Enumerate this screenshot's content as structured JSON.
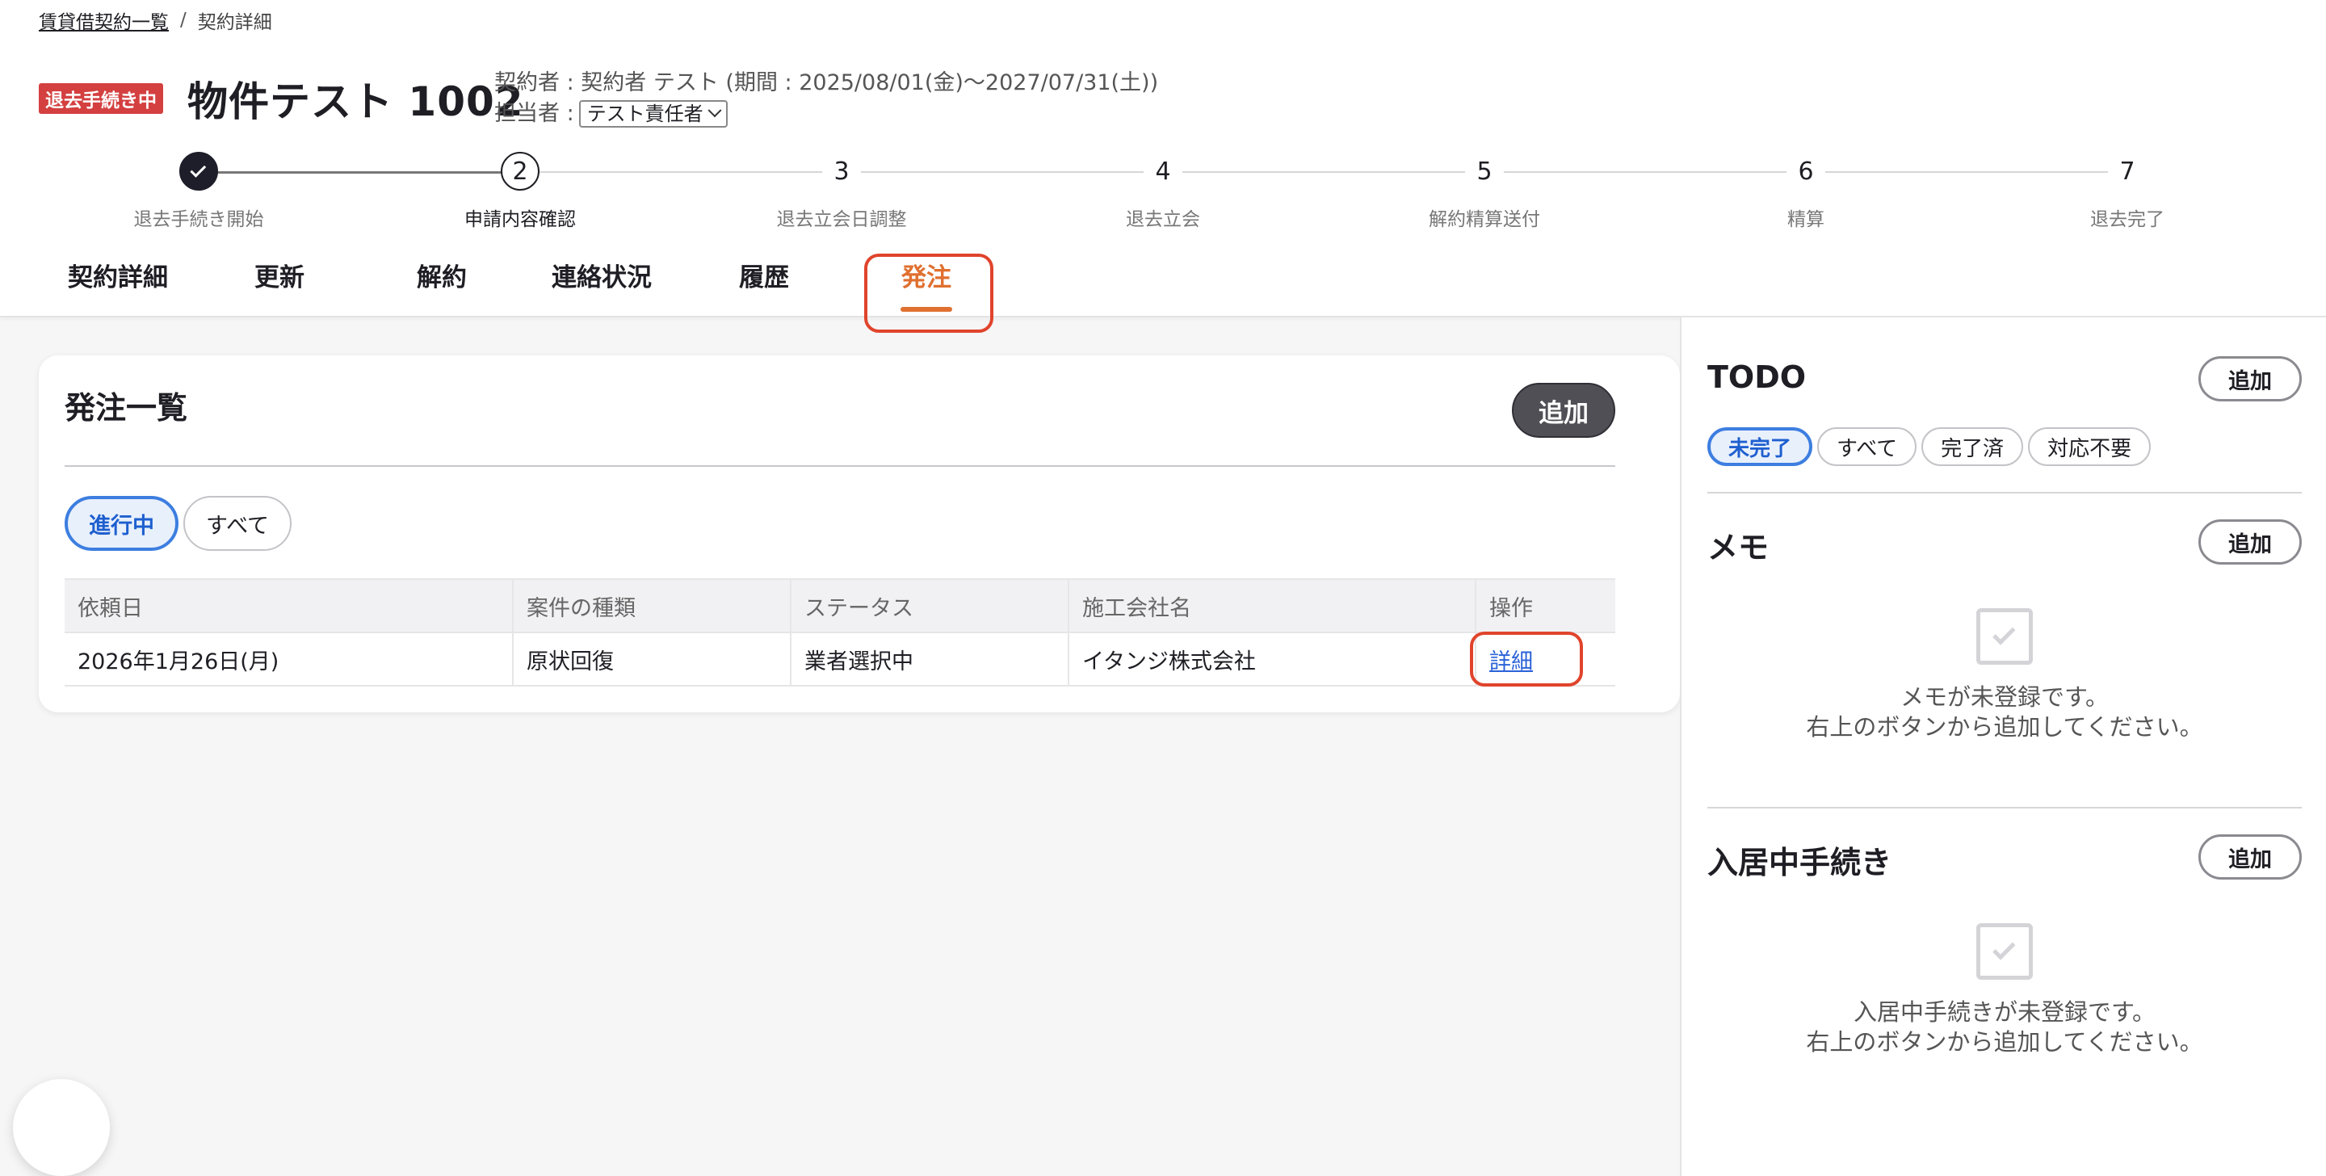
{
  "breadcrumb": {
    "parent": "賃貸借契約一覧",
    "separator": "/",
    "current": "契約詳細"
  },
  "header": {
    "status_badge": "退去手続き中",
    "property_title": "物件テスト 1002",
    "contract_info": "契約者 : 契約者 テスト (期間 : 2025/08/01(金)〜2027/07/31(土))",
    "assignee_label": "担当者 :",
    "assignee_value": "テスト責任者"
  },
  "stepper": {
    "steps": [
      {
        "number": "1",
        "label": "退去手続き開始",
        "state": "done"
      },
      {
        "number": "2",
        "label": "申請内容確認",
        "state": "current"
      },
      {
        "number": "3",
        "label": "退去立会日調整",
        "state": "pending"
      },
      {
        "number": "4",
        "label": "退去立会",
        "state": "pending"
      },
      {
        "number": "5",
        "label": "解約精算送付",
        "state": "pending"
      },
      {
        "number": "6",
        "label": "精算",
        "state": "pending"
      },
      {
        "number": "7",
        "label": "退去完了",
        "state": "pending"
      }
    ]
  },
  "tabs": [
    {
      "label": "契約詳細"
    },
    {
      "label": "更新"
    },
    {
      "label": "解約"
    },
    {
      "label": "連絡状況"
    },
    {
      "label": "履歴"
    },
    {
      "label": "発注",
      "active": true
    }
  ],
  "orders": {
    "title": "発注一覧",
    "add_label": "追加",
    "filters": [
      {
        "label": "進行中",
        "active": true
      },
      {
        "label": "すべて"
      }
    ],
    "columns": [
      "依頼日",
      "案件の種類",
      "ステータス",
      "施工会社名",
      "操作"
    ],
    "rows": [
      {
        "date": "2026年1月26日(月)",
        "type": "原状回復",
        "status": "業者選択中",
        "company": "イタンジ株式会社",
        "action": "詳細"
      }
    ]
  },
  "sidebar": {
    "todo": {
      "title": "TODO",
      "add_label": "追加",
      "filters": [
        {
          "label": "未完了",
          "active": true
        },
        {
          "label": "すべて"
        },
        {
          "label": "完了済"
        },
        {
          "label": "対応不要"
        }
      ]
    },
    "memo": {
      "title": "メモ",
      "add_label": "追加",
      "empty_line1": "メモが未登録です。",
      "empty_line2": "右上のボタンから追加してください。"
    },
    "procedures": {
      "title": "入居中手続き",
      "add_label": "追加",
      "empty_line1": "入居中手続きが未登録です。",
      "empty_line2": "右上のボタンから追加してください。"
    }
  },
  "colors": {
    "accent": "#e07030",
    "badge": "#d44040",
    "link": "#2a62d8",
    "highlight": "#e0442c",
    "chip_active": "#3d7ee0"
  }
}
